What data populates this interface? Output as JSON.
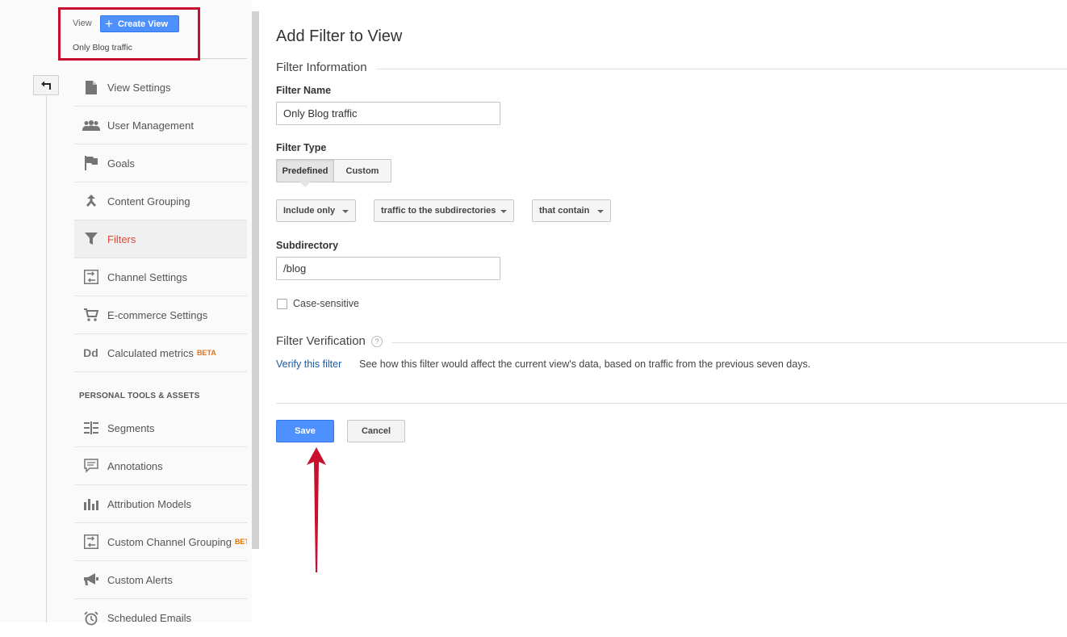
{
  "colors": {
    "accent_blue": "#4d90fe",
    "active_red": "#dd4b39",
    "beta_orange": "#e8710a",
    "annotation_red": "#c8102e",
    "link_blue": "#1a5aa6"
  },
  "view_header": {
    "label": "View",
    "create_button": "Create View",
    "view_name": "Only Blog traffic"
  },
  "back_button_icon": "back-arrow-icon",
  "sidebar": {
    "items": [
      {
        "label": "View Settings",
        "icon": "document-icon"
      },
      {
        "label": "User Management",
        "icon": "users-icon"
      },
      {
        "label": "Goals",
        "icon": "flag-icon"
      },
      {
        "label": "Content Grouping",
        "icon": "merge-icon"
      },
      {
        "label": "Filters",
        "icon": "funnel-icon",
        "active": true
      },
      {
        "label": "Channel Settings",
        "icon": "channel-icon"
      },
      {
        "label": "E-commerce Settings",
        "icon": "cart-icon"
      },
      {
        "label": "Calculated metrics",
        "icon": "dd-icon",
        "badge": "BETA"
      }
    ],
    "section_heading": "PERSONAL TOOLS & ASSETS",
    "tools": [
      {
        "label": "Segments",
        "icon": "segments-icon"
      },
      {
        "label": "Annotations",
        "icon": "comment-icon"
      },
      {
        "label": "Attribution Models",
        "icon": "bar-chart-icon"
      },
      {
        "label": "Custom Channel Grouping",
        "icon": "channel-icon",
        "badge": "BET"
      },
      {
        "label": "Custom Alerts",
        "icon": "megaphone-icon"
      },
      {
        "label": "Scheduled Emails",
        "icon": "alarm-clock-icon"
      }
    ]
  },
  "main": {
    "title": "Add Filter to View",
    "filter_information": "Filter Information",
    "filter_name_label": "Filter Name",
    "filter_name_value": "Only Blog traffic",
    "filter_type_label": "Filter Type",
    "filter_type_tabs": [
      "Predefined",
      "Custom"
    ],
    "filter_type_selected": "Predefined",
    "dropdowns": {
      "include": "Include only",
      "source": "traffic to the subdirectories",
      "expression": "that contain"
    },
    "subdirectory_label": "Subdirectory",
    "subdirectory_value": "/blog",
    "case_sensitive_label": "Case-sensitive",
    "case_sensitive_checked": false,
    "filter_verification": "Filter Verification",
    "help_glyph": "?",
    "verify_link": "Verify this filter",
    "verify_description": "See how this filter would affect the current view's data, based on traffic from the previous seven days.",
    "save_label": "Save",
    "cancel_label": "Cancel"
  }
}
